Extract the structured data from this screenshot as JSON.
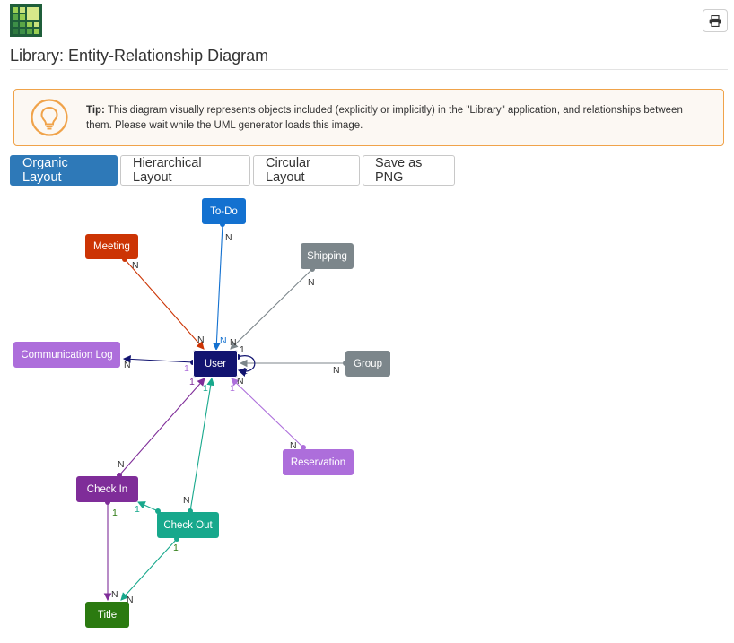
{
  "header": {
    "logo_icon": "grid-logo-icon",
    "print_icon": "print-icon",
    "title": "Library: Entity-Relationship Diagram"
  },
  "tip": {
    "icon": "lightbulb-icon",
    "label": "Tip:",
    "text_line1": "This diagram visually represents objects included (explicitly or implicitly) in the \"Library\" application, and relationships between",
    "text_line2": "them. Please wait while the UML generator loads this image."
  },
  "toolbar": {
    "organic": "Organic Layout",
    "hierarchical": "Hierarchical Layout",
    "circular": "Circular Layout",
    "save_png": "Save as PNG"
  },
  "diagram": {
    "nodes": {
      "todo": {
        "label": "To-Do",
        "color": "#1371d0"
      },
      "meeting": {
        "label": "Meeting",
        "color": "#cc3404"
      },
      "shipping": {
        "label": "Shipping",
        "color": "#7c868b"
      },
      "comm_log": {
        "label": "Communication Log",
        "color": "#ad6edb"
      },
      "user": {
        "label": "User",
        "color": "#121470"
      },
      "group": {
        "label": "Group",
        "color": "#7c868b"
      },
      "reservation": {
        "label": "Reservation",
        "color": "#ad6edb"
      },
      "check_in": {
        "label": "Check In",
        "color": "#7f2d99"
      },
      "check_out": {
        "label": "Check Out",
        "color": "#17a88c"
      },
      "title": {
        "label": "Title",
        "color": "#2b7a10"
      }
    },
    "cardinality": {
      "many": "N",
      "one": "1"
    }
  }
}
